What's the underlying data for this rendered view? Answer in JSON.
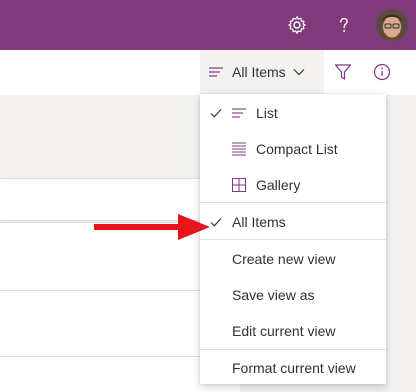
{
  "suite_bar": {
    "icons": [
      "gear-icon",
      "help-icon"
    ],
    "colors": {
      "background": "#80397b",
      "icon": "#ffffff"
    }
  },
  "command_bar": {
    "view_switcher_label": "All Items",
    "icons": [
      "list-view-icon",
      "chevron-down-icon",
      "filter-icon",
      "info-icon"
    ],
    "accent": "#80397b"
  },
  "view_menu": {
    "items": [
      {
        "label": "List",
        "checked": true,
        "icon": "list-icon"
      },
      {
        "label": "Compact List",
        "checked": false,
        "icon": "compact-list-icon"
      },
      {
        "label": "Gallery",
        "checked": false,
        "icon": "gallery-icon"
      },
      {
        "label": "All Items",
        "checked": true,
        "icon": ""
      },
      {
        "label": "Create new view",
        "checked": false,
        "icon": ""
      },
      {
        "label": "Save view as",
        "checked": false,
        "icon": ""
      },
      {
        "label": "Edit current view",
        "checked": false,
        "icon": ""
      },
      {
        "label": "Format current view",
        "checked": false,
        "icon": ""
      }
    ]
  },
  "annotation": {
    "icon": "red-arrow-icon",
    "color": "#e8141b"
  }
}
